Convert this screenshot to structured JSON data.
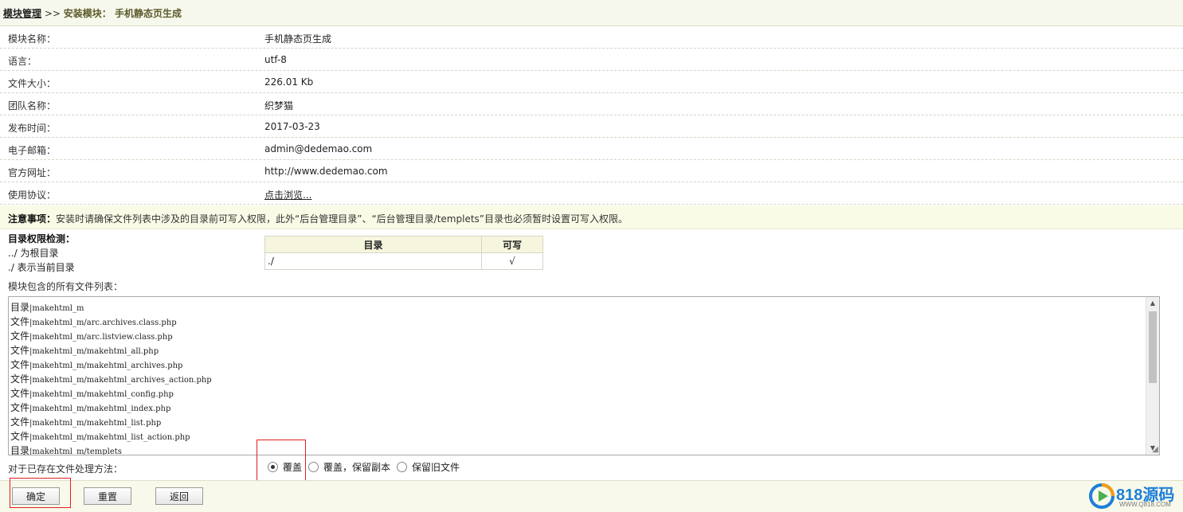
{
  "breadcrumb": {
    "root": "模块管理",
    "sep": " >> ",
    "current": "安装模块： 手机静态页生成"
  },
  "info_rows": [
    {
      "label": "模块名称：",
      "value": "手机静态页生成"
    },
    {
      "label": "语言：",
      "value": "utf-8"
    },
    {
      "label": "文件大小：",
      "value": "226.01 Kb"
    },
    {
      "label": "团队名称：",
      "value": "织梦猫"
    },
    {
      "label": "发布时间：",
      "value": "2017-03-23"
    },
    {
      "label": "电子邮箱：",
      "value": "admin@dedemao.com"
    },
    {
      "label": "官方网址：",
      "value": "http://www.dedemao.com"
    },
    {
      "label": "使用协议：",
      "value": "点击浏览..."
    }
  ],
  "notice": {
    "title": "注意事项：",
    "text": "安装时请确保文件列表中涉及的目录前可写入权限，此外“后台管理目录”、“后台管理目录/templets”目录也必须暂时设置可写入权限。"
  },
  "perm": {
    "title": "目录权限检测：",
    "line1": "../ 为根目录",
    "line2": "./ 表示当前目录",
    "headers": [
      "目录",
      "可写"
    ],
    "rows": [
      {
        "dir": "./",
        "writable": "√"
      }
    ]
  },
  "files_label": "模块包含的所有文件列表：",
  "files": [
    {
      "kind": "目录",
      "path": "|makehtml_m"
    },
    {
      "kind": "文件",
      "path": "|makehtml_m/arc.archives.class.php"
    },
    {
      "kind": "文件",
      "path": "|makehtml_m/arc.listview.class.php"
    },
    {
      "kind": "文件",
      "path": "|makehtml_m/makehtml_all.php"
    },
    {
      "kind": "文件",
      "path": "|makehtml_m/makehtml_archives.php"
    },
    {
      "kind": "文件",
      "path": "|makehtml_m/makehtml_archives_action.php"
    },
    {
      "kind": "文件",
      "path": "|makehtml_m/makehtml_config.php"
    },
    {
      "kind": "文件",
      "path": "|makehtml_m/makehtml_index.php"
    },
    {
      "kind": "文件",
      "path": "|makehtml_m/makehtml_list.php"
    },
    {
      "kind": "文件",
      "path": "|makehtml_m/makehtml_list_action.php"
    },
    {
      "kind": "目录",
      "path": "|makehtml_m/templets"
    }
  ],
  "method": {
    "label": "对于已存在文件处理方法：",
    "options": [
      "覆盖",
      "覆盖，保留副本",
      "保留旧文件"
    ],
    "selected": 0
  },
  "buttons": {
    "confirm": "确定",
    "reset": "重置",
    "back": "返回"
  },
  "logo": {
    "text": "818源码",
    "sub": "WWW.Q818.COM",
    "color": "#1e7fd8"
  }
}
